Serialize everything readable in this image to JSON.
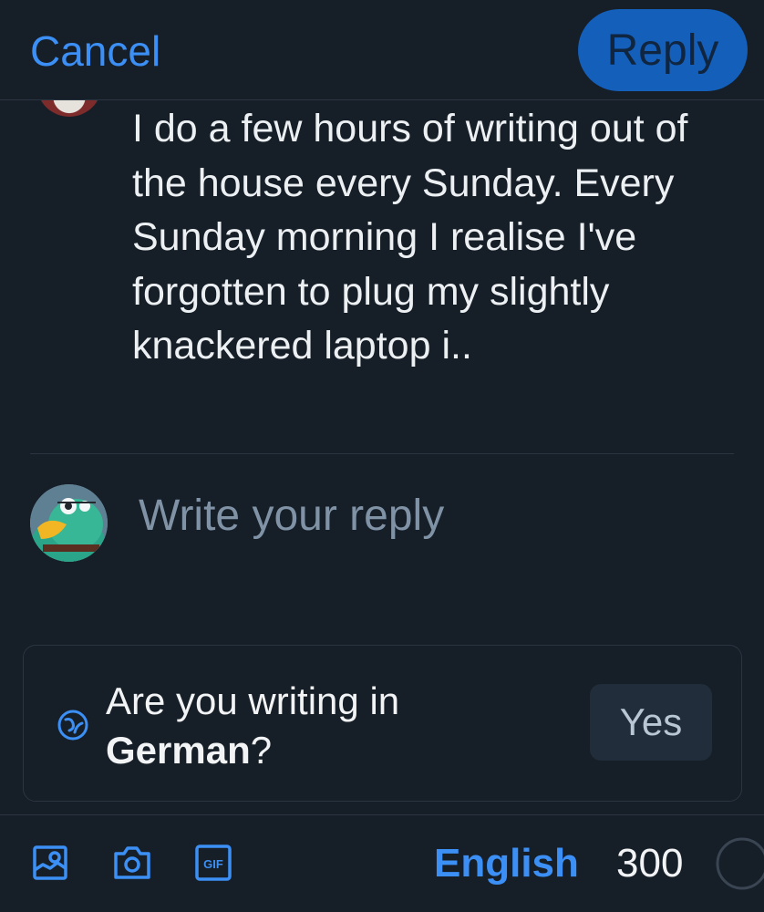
{
  "header": {
    "cancel_label": "Cancel",
    "reply_label": "Reply"
  },
  "parent_post": {
    "text": "I do a few hours of writing out of the house every Sunday. Every Sunday morning I realise I've forgotten to plug my slightly knackered laptop i.."
  },
  "composer": {
    "placeholder": "Write your reply"
  },
  "language_prompt": {
    "question_prefix": "Are you writing in",
    "language": "German",
    "question_suffix": "?",
    "yes_label": "Yes"
  },
  "toolbar": {
    "icons": [
      "image-icon",
      "camera-icon",
      "gif-icon"
    ],
    "gif_text": "GIF",
    "language_label": "English",
    "char_count": "300",
    "char_limit_used_fraction": 0
  },
  "colors": {
    "background": "#161e27",
    "accent": "#3b8ff5",
    "reply_button_disabled": "#135fba",
    "divider": "#2b3542",
    "placeholder": "#8092a5"
  }
}
